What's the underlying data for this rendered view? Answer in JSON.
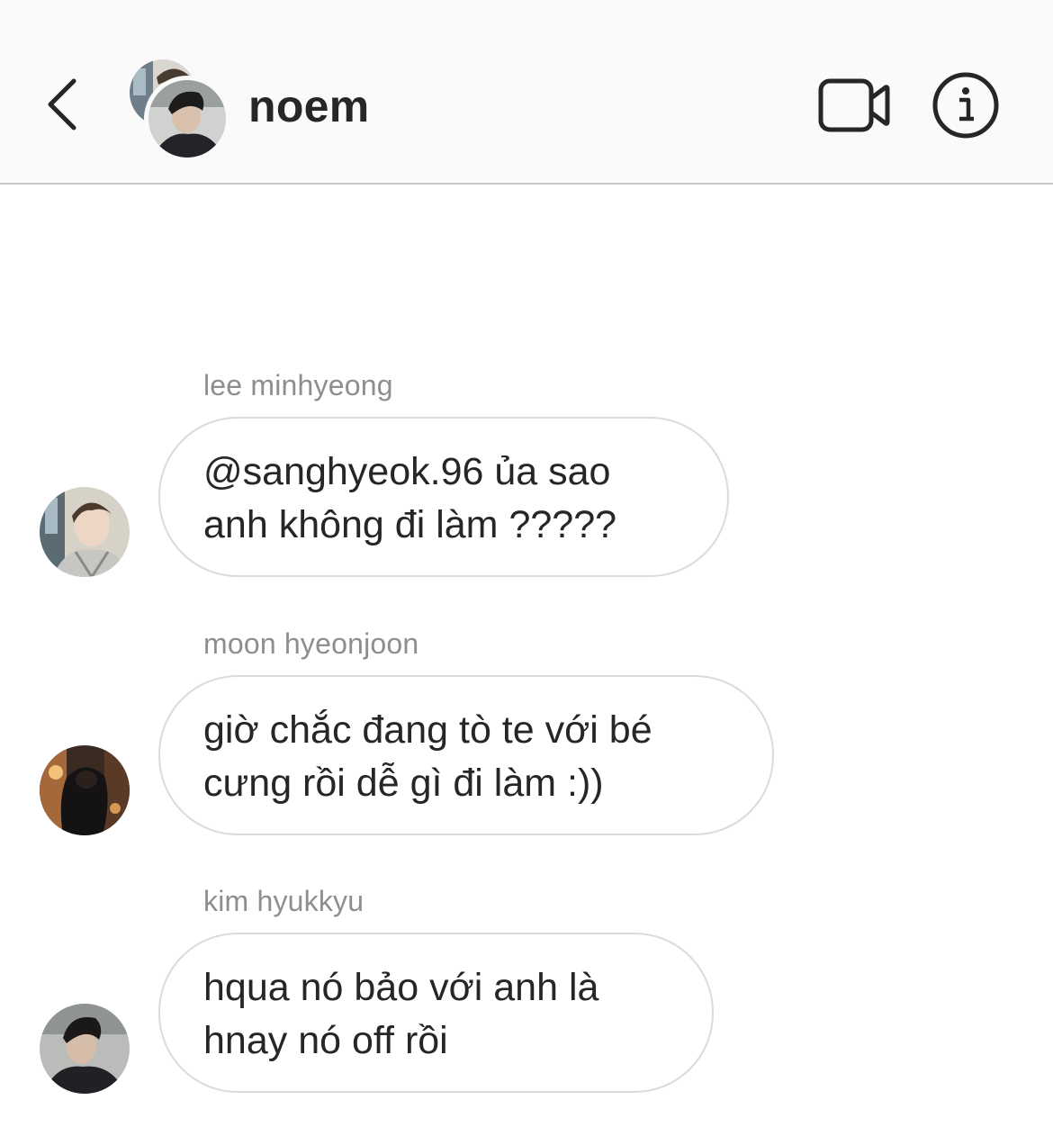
{
  "header": {
    "title": "noem",
    "back_icon": "chevron-left-icon",
    "video_icon": "video-camera-icon",
    "info_icon": "info-icon"
  },
  "messages": [
    {
      "sender": "lee minhyeong",
      "text": "@sanghyeok.96 ủa sao\nanh không đi làm ?????"
    },
    {
      "sender": "moon hyeonjoon",
      "text": "giờ chắc đang tò te với bé\ncưng rồi dễ gì đi làm :))"
    },
    {
      "sender": "kim hyukkyu",
      "text": "hqua nó bảo với anh là\nhnay nó off rồi"
    }
  ],
  "colors": {
    "header_bg": "#fafafa",
    "divider": "#c8c8c8",
    "bubble_border": "#dbdbdb",
    "sender_text": "#8e8e8e",
    "text": "#262626"
  }
}
